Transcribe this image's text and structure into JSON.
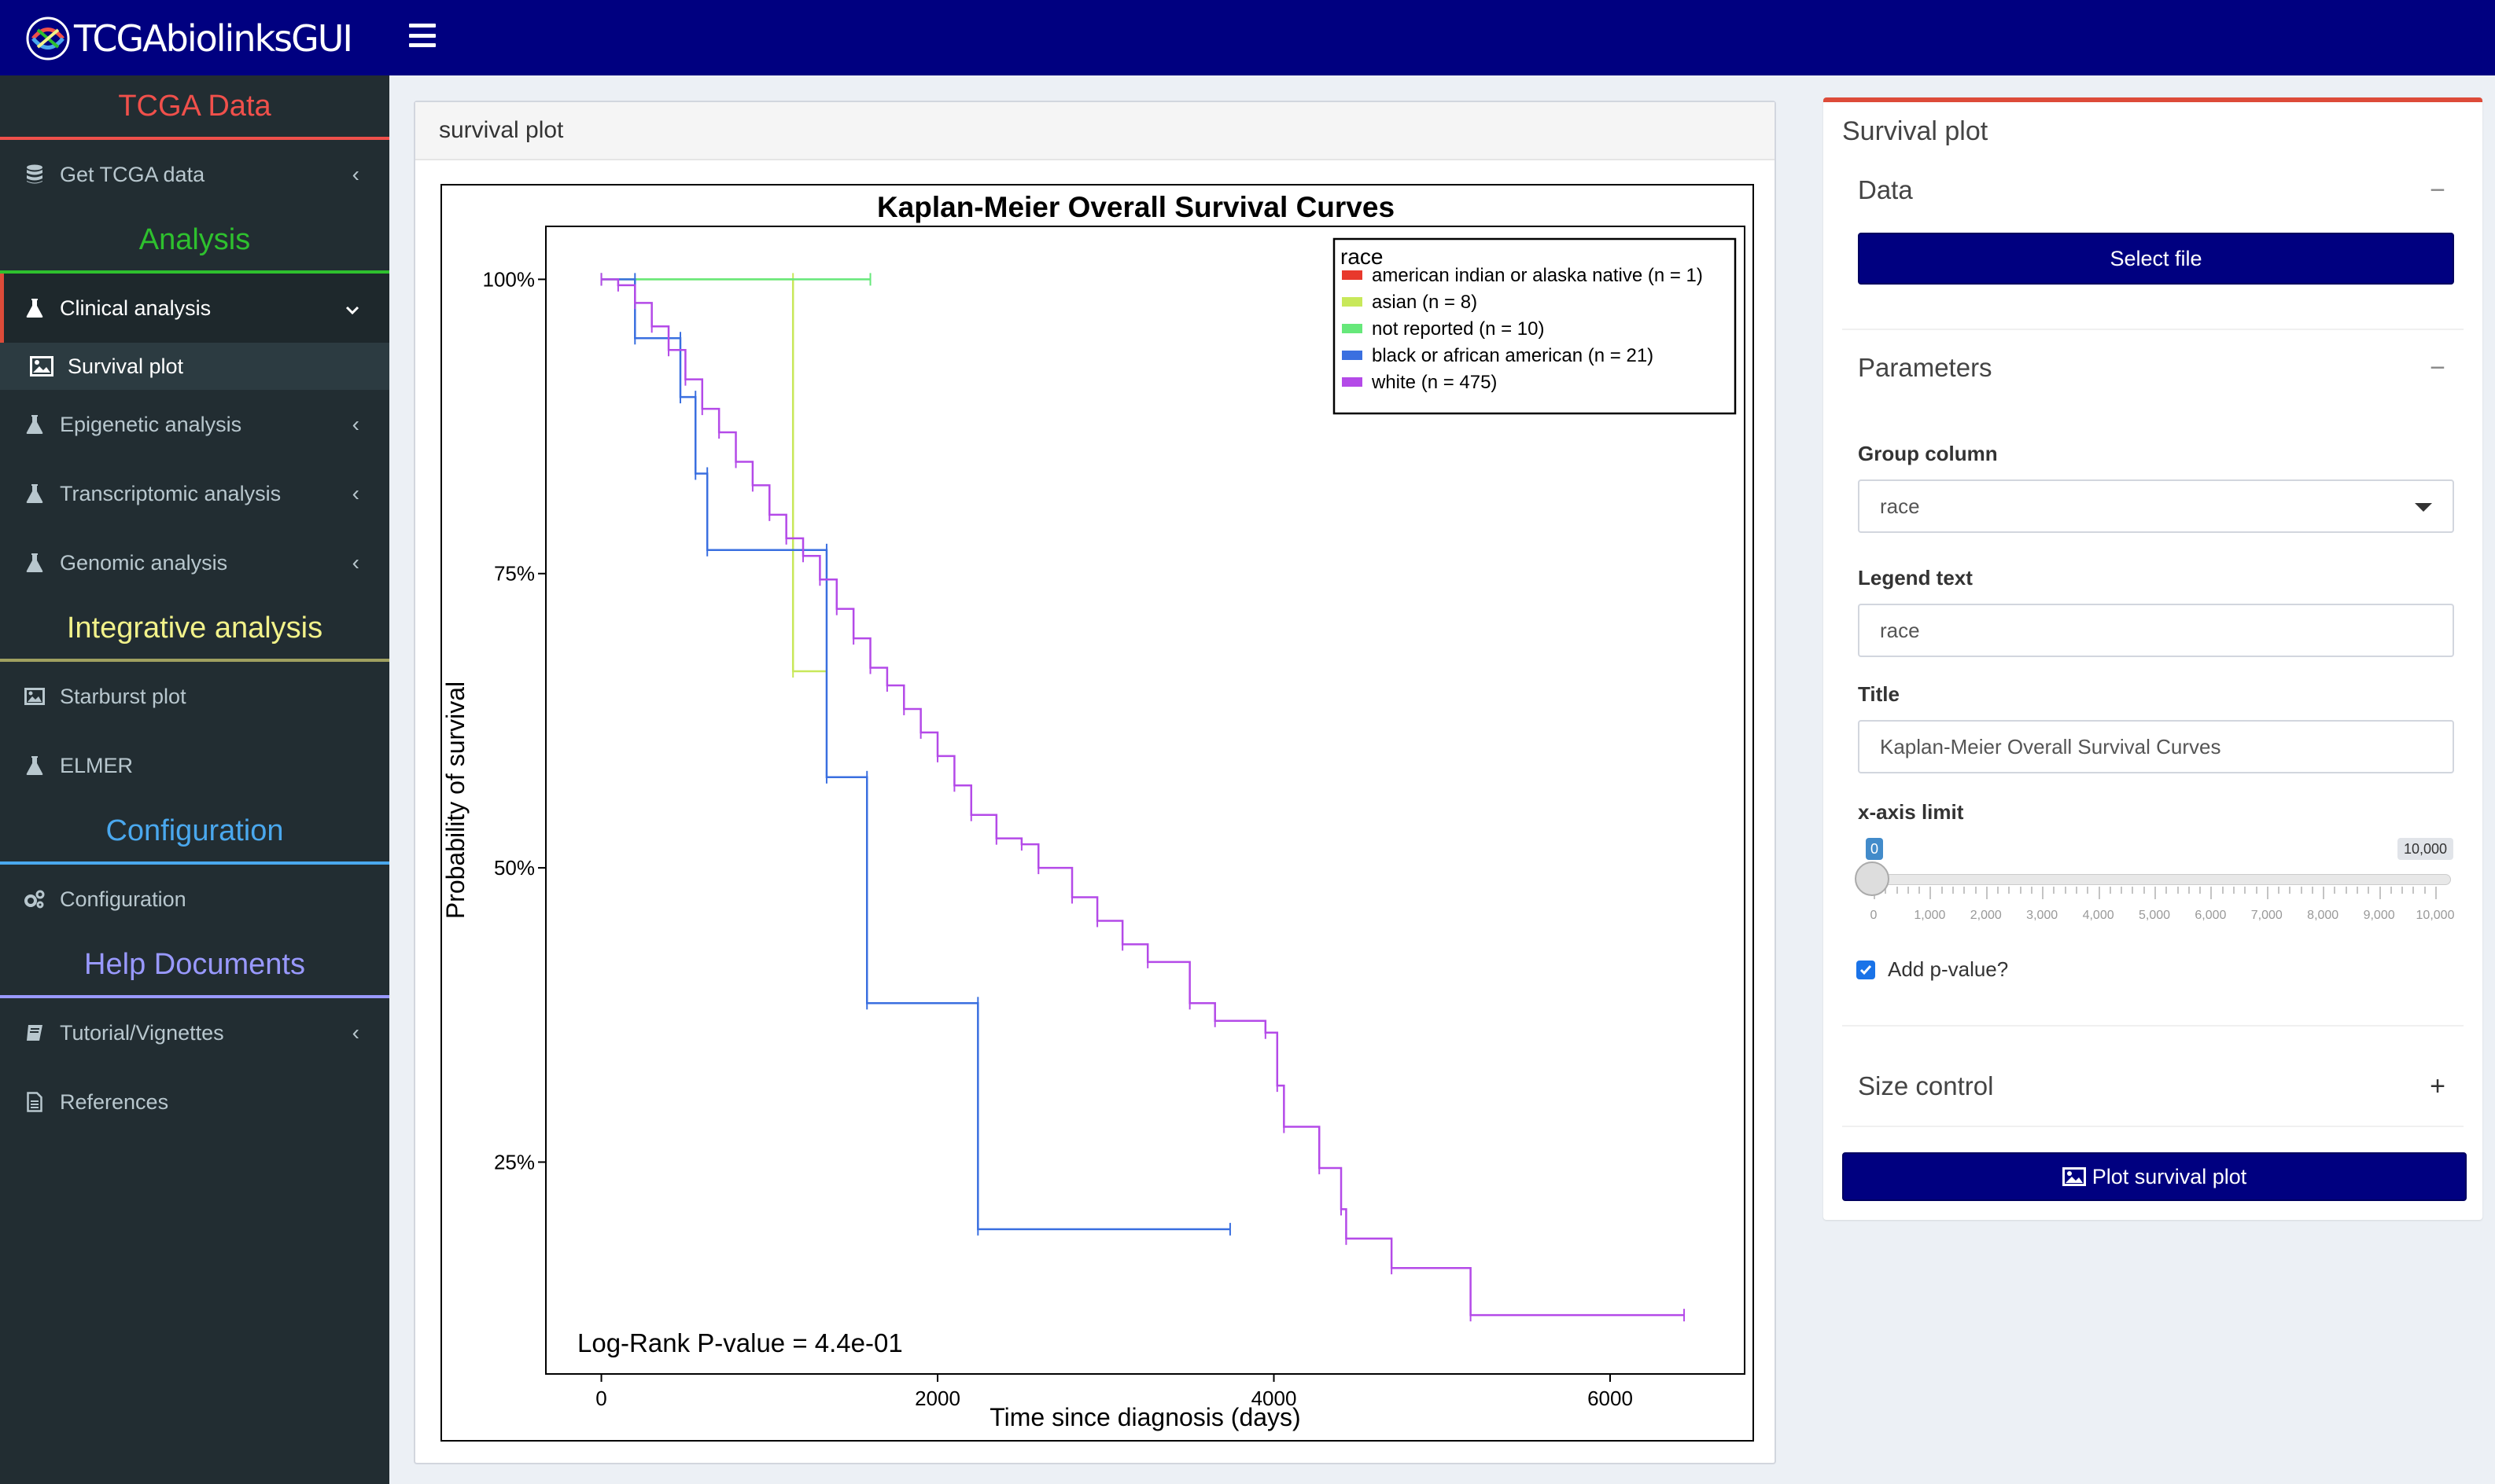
{
  "header": {
    "brand": "TCGAbiolinksGUI",
    "menu_icon": "hamburger-icon"
  },
  "sidebar": {
    "section_tcga": "TCGA Data",
    "get_tcga": "Get TCGA data",
    "section_analysis": "Analysis",
    "clinical": "Clinical analysis",
    "survival": "Survival plot",
    "epigenetic": "Epigenetic analysis",
    "transcriptomic": "Transcriptomic analysis",
    "genomic": "Genomic analysis",
    "section_integrative": "Integrative analysis",
    "starburst": "Starburst plot",
    "elmer": "ELMER",
    "section_config": "Configuration",
    "configuration": "Configuration",
    "section_help": "Help Documents",
    "tutorial": "Tutorial/Vignettes",
    "references": "References",
    "colors": {
      "tcga": "#f0504b",
      "analysis": "#2ec02e",
      "integrative": "#f2f28a",
      "config": "#4aa8ee",
      "help": "#9999ff"
    }
  },
  "plot_panel": {
    "header": "survival plot"
  },
  "chart_data": {
    "type": "line",
    "title": "Kaplan-Meier Overall Survival Curves",
    "xlabel": "Time since diagnosis (days)",
    "ylabel": "Probability of survival",
    "x_ticks": [
      "0",
      "2000",
      "4000",
      "6000"
    ],
    "y_ticks": [
      "25%",
      "50%",
      "75%",
      "100%"
    ],
    "xlim": [
      -330,
      6800
    ],
    "ylim": [
      0.07,
      1.045
    ],
    "pvalue_text": "Log-Rank P-value = 4.4e-01",
    "legend_title": "race",
    "legend_position": "top-right",
    "series": [
      {
        "name": "american indian or alaska native (n = 1)",
        "color": "#e8392c",
        "steps": [
          [
            0,
            1.0
          ]
        ]
      },
      {
        "name": "asian (n = 8)",
        "color": "#c8e85a",
        "steps": [
          [
            0,
            1.0
          ],
          [
            1140,
            1.0
          ],
          [
            1140,
            0.667
          ],
          [
            1340,
            0.667
          ]
        ]
      },
      {
        "name": "not reported (n = 10)",
        "color": "#66e87a",
        "steps": [
          [
            0,
            1.0
          ],
          [
            1600,
            1.0
          ]
        ]
      },
      {
        "name": "black or african american (n = 21)",
        "color": "#3a6fe0",
        "steps": [
          [
            0,
            1.0
          ],
          [
            200,
            1.0
          ],
          [
            200,
            0.95
          ],
          [
            470,
            0.95
          ],
          [
            470,
            0.9
          ],
          [
            560,
            0.9
          ],
          [
            560,
            0.835
          ],
          [
            630,
            0.835
          ],
          [
            630,
            0.77
          ],
          [
            1340,
            0.77
          ],
          [
            1340,
            0.577
          ],
          [
            1580,
            0.577
          ],
          [
            1580,
            0.385
          ],
          [
            2240,
            0.385
          ],
          [
            2240,
            0.193
          ],
          [
            3740,
            0.193
          ]
        ]
      },
      {
        "name": "white (n = 475)",
        "color": "#b44ae8",
        "steps": [
          [
            0,
            1.0
          ],
          [
            100,
            0.995
          ],
          [
            200,
            0.98
          ],
          [
            300,
            0.96
          ],
          [
            400,
            0.94
          ],
          [
            500,
            0.915
          ],
          [
            600,
            0.89
          ],
          [
            700,
            0.87
          ],
          [
            800,
            0.845
          ],
          [
            900,
            0.825
          ],
          [
            1000,
            0.8
          ],
          [
            1100,
            0.78
          ],
          [
            1200,
            0.765
          ],
          [
            1300,
            0.745
          ],
          [
            1400,
            0.72
          ],
          [
            1500,
            0.695
          ],
          [
            1600,
            0.67
          ],
          [
            1700,
            0.655
          ],
          [
            1800,
            0.635
          ],
          [
            1900,
            0.615
          ],
          [
            2000,
            0.595
          ],
          [
            2100,
            0.57
          ],
          [
            2200,
            0.545
          ],
          [
            2350,
            0.525
          ],
          [
            2500,
            0.52
          ],
          [
            2600,
            0.5
          ],
          [
            2800,
            0.475
          ],
          [
            2950,
            0.455
          ],
          [
            3100,
            0.435
          ],
          [
            3250,
            0.42
          ],
          [
            3500,
            0.385
          ],
          [
            3650,
            0.37
          ],
          [
            3950,
            0.36
          ],
          [
            4020,
            0.315
          ],
          [
            4060,
            0.28
          ],
          [
            4270,
            0.245
          ],
          [
            4400,
            0.21
          ],
          [
            4430,
            0.185
          ],
          [
            4700,
            0.16
          ],
          [
            5170,
            0.12
          ],
          [
            6440,
            0.12
          ]
        ]
      }
    ]
  },
  "right_panel": {
    "title": "Survival plot",
    "data_header": "Data",
    "select_file": "Select file",
    "params_header": "Parameters",
    "group_label": "Group column",
    "group_value": "race",
    "legend_label": "Legend text",
    "legend_value": "race",
    "title_label": "Title",
    "title_value": "Kaplan-Meier Overall Survival Curves",
    "xlimit_label": "x-axis limit",
    "slider_min": "0",
    "slider_max": "10,000",
    "slider_value": 0,
    "slider_ticks": [
      "0",
      "1,000",
      "2,000",
      "3,000",
      "4,000",
      "5,000",
      "6,000",
      "7,000",
      "8,000",
      "9,000",
      "10,000"
    ],
    "pvalue_label": "Add p-value?",
    "pvalue_checked": true,
    "size_header": "Size control",
    "plot_button": "Plot survival plot"
  }
}
